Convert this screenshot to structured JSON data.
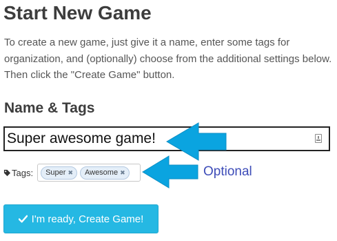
{
  "header": {
    "title": "Start New Game",
    "description": "To create a new game, just give it a name, enter some tags for organization, and (optionally) choose from the additional settings below. Then click the \"Create Game\" button."
  },
  "name_tags": {
    "heading": "Name & Tags",
    "name_value": "Super awesome game!",
    "tags_label": "Tags:",
    "tags": [
      "Super",
      "Awesome"
    ],
    "tag_remove_glyph": "✖",
    "optional_label": "Optional"
  },
  "actions": {
    "create_label": "I'm ready, Create Game!"
  },
  "colors": {
    "arrow": "#0aa4e0",
    "button": "#25b8e3",
    "optional_text": "#3d4cb8"
  }
}
